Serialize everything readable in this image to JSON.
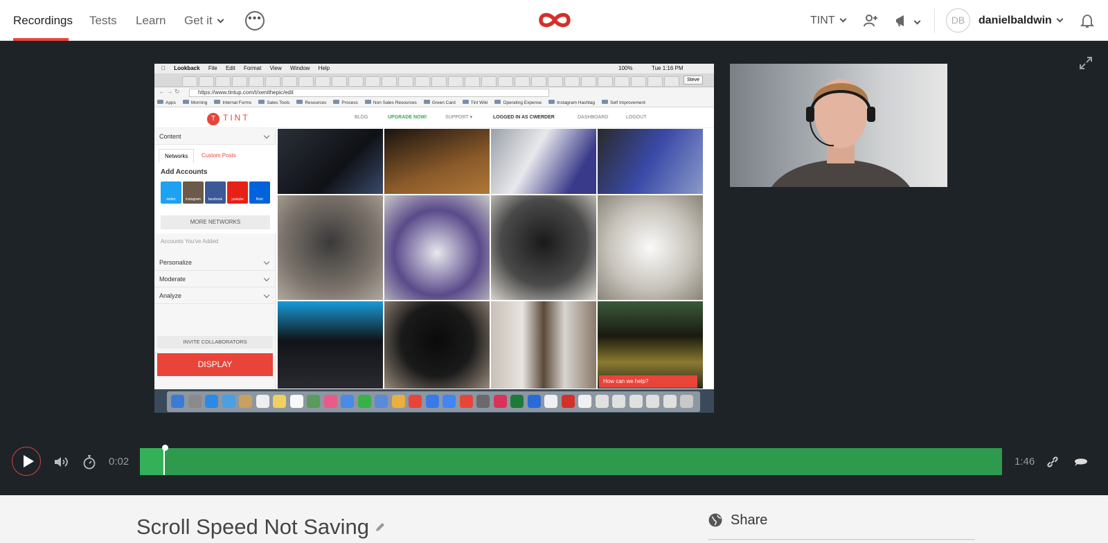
{
  "nav": {
    "items": [
      {
        "label": "Recordings",
        "active": true
      },
      {
        "label": "Tests",
        "active": false
      },
      {
        "label": "Learn",
        "active": false
      },
      {
        "label": "Get it",
        "active": false
      }
    ],
    "more_label": "•••",
    "workspace": "TINT",
    "user_initials": "DB",
    "username": "danielbaldwin",
    "accent_color": "#e8443a"
  },
  "recording": {
    "mac_menu": [
      "Lookback",
      "File",
      "Edit",
      "Format",
      "View",
      "Window",
      "Help"
    ],
    "mac_clock": "Tue 1:16 PM",
    "mac_battery": "100%",
    "browser_profile": "Steve",
    "url": "https://www.tintup.com/t/xenithepic/edit",
    "bookmarks": [
      "Apps",
      "Morning",
      "Internal Forms",
      "Sales Tools",
      "Resources",
      "Process",
      "Non Sales Resources",
      "Green Card",
      "Tint Wiki",
      "Operating Expense",
      "Instagram Hashtag",
      "Self Improvement"
    ],
    "tint": {
      "logo": "TINT",
      "nav": [
        "BLOG",
        "UPGRADE NOW!",
        "SUPPORT ▾",
        "LOGGED IN AS CWERDER",
        "DASHBOARD",
        "LOGOUT"
      ],
      "panels": [
        "Content",
        "Personalize",
        "Moderate",
        "Analyze"
      ],
      "subtabs": [
        "Networks",
        "Custom Posts"
      ],
      "add_accounts": "Add Accounts",
      "networks": [
        "twitter",
        "instagram",
        "facebook",
        "youtube",
        "flickr"
      ],
      "more_networks": "MORE NETWORKS",
      "accounts_added": "Accounts You've Added",
      "invite": "INVITE COLLABORATORS",
      "display": "DISPLAY",
      "help": "How can we help?"
    }
  },
  "player": {
    "current_time": "0:02",
    "total_time": "1:46",
    "progress_fraction": 0.027
  },
  "details": {
    "title": "Scroll Speed Not Saving",
    "share_label": "Share"
  }
}
